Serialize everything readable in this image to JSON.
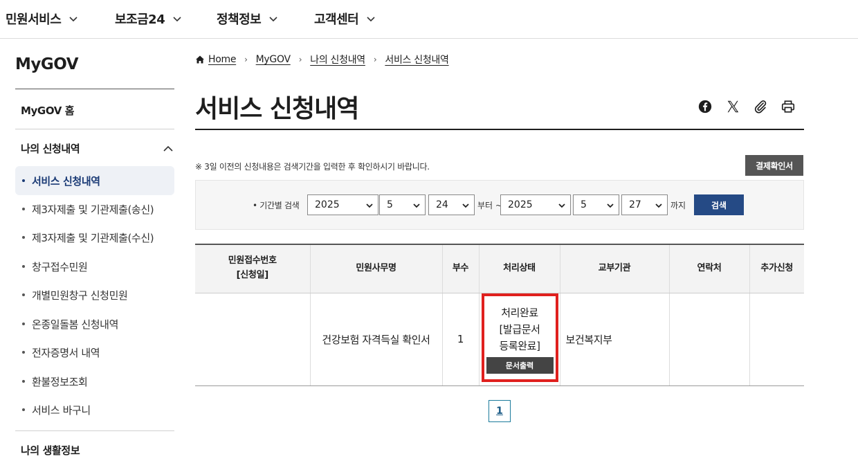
{
  "topnav": {
    "items": [
      {
        "label": "민원서비스"
      },
      {
        "label": "보조금24"
      },
      {
        "label": "정책정보"
      },
      {
        "label": "고객센터"
      }
    ]
  },
  "sidebar": {
    "brand": "MyGOV",
    "home": "MyGOV 홈",
    "section": "나의 신청내역",
    "items": [
      {
        "label": "서비스 신청내역"
      },
      {
        "label": "제3자제출 및 기관제출(송신)"
      },
      {
        "label": "제3자제출 및 기관제출(수신)"
      },
      {
        "label": "창구접수민원"
      },
      {
        "label": "개별민원창구 신청민원"
      },
      {
        "label": "온종일돌봄 신청내역"
      },
      {
        "label": "전자증명서 내역"
      },
      {
        "label": "환불정보조회"
      },
      {
        "label": "서비스 바구니"
      }
    ],
    "section2": "나의 생활정보"
  },
  "breadcrumb": [
    "Home",
    "MyGOV",
    "나의 신청내역",
    "서비스 신청내역"
  ],
  "page_title": "서비스 신청내역",
  "notice": "※ 3일 이전의 신청내용은 검색기간을 입력한 후 확인하시기 바랍니다.",
  "receipt_button": "결제확인서",
  "search": {
    "label": "• 기간별 검색",
    "from_year": "2025",
    "from_month": "5",
    "from_day": "24",
    "from_suffix": "부터 ~",
    "to_year": "2025",
    "to_month": "5",
    "to_day": "27",
    "to_suffix": "까지",
    "button": "검색"
  },
  "table": {
    "headers": {
      "receipt_no": "민원접수번호",
      "receipt_date": "[신청일]",
      "service": "민원사무명",
      "copies": "부수",
      "status": "처리상태",
      "agency": "교부기관",
      "contact": "연락처",
      "extra": "추가신청"
    },
    "row": {
      "receipt_no": "",
      "service": "건강보험 자격득실 확인서",
      "copies": "1",
      "status_line1": "처리완료",
      "status_line2": "[발급문서",
      "status_line3": "등록완료]",
      "print_button": "문서출력",
      "agency": "보건복지부",
      "contact": "",
      "extra": ""
    }
  },
  "pagination": {
    "current": "1"
  },
  "colors": {
    "accent": "#254a85",
    "highlight": "#e0201e"
  }
}
